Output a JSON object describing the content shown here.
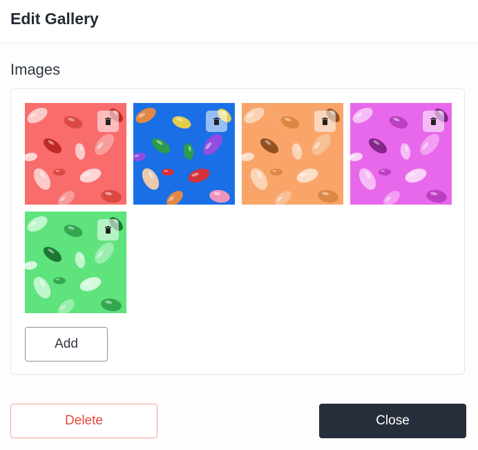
{
  "dialog": {
    "title": "Edit Gallery"
  },
  "images_section": {
    "label": "Images",
    "add_label": "Add"
  },
  "images": [
    {
      "name": "red-beans",
      "bg": "#f96c6c",
      "beans": [
        "#fbd3d0",
        "#d9473f",
        "#f7a2a0",
        "#b8241f",
        "#fde0dd"
      ]
    },
    {
      "name": "multicolor-beans",
      "bg": "#1a6fe6",
      "beans": [
        "#f28a3a",
        "#f5d53b",
        "#9b4be0",
        "#2e9e3c",
        "#e42b2b",
        "#fbd1a8",
        "#ff98b8"
      ]
    },
    {
      "name": "orange-beans",
      "bg": "#f9a56a",
      "beans": [
        "#fbd8bd",
        "#d98540",
        "#f7c29a",
        "#8a4a1c",
        "#fde4cf"
      ]
    },
    {
      "name": "pink-beans",
      "bg": "#e768ea",
      "beans": [
        "#f6c4f6",
        "#b83cbf",
        "#f4a3f3",
        "#7b1f80",
        "#fbdcfb"
      ]
    },
    {
      "name": "green-beans",
      "bg": "#5fe37d",
      "beans": [
        "#c8f8d2",
        "#2fa24a",
        "#9ff0b2",
        "#1a6e2e",
        "#dffbe5"
      ]
    }
  ],
  "footer": {
    "delete_label": "Delete",
    "close_label": "Close"
  }
}
